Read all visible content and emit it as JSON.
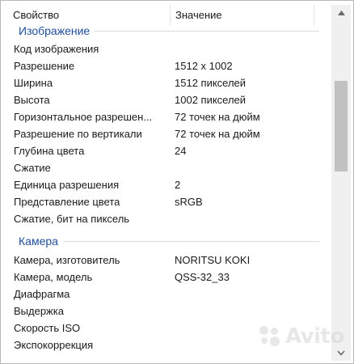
{
  "header": {
    "property_col": "Свойство",
    "value_col": "Значение"
  },
  "groups": [
    {
      "title": "Изображение",
      "rows": [
        {
          "property": "Код изображения",
          "value": ""
        },
        {
          "property": "Разрешение",
          "value": "1512 x 1002"
        },
        {
          "property": "Ширина",
          "value": "1512 пикселей"
        },
        {
          "property": "Высота",
          "value": "1002 пикселей"
        },
        {
          "property": "Горизонтальное разрешен...",
          "value": "72 точек на дюйм"
        },
        {
          "property": "Разрешение по вертикали",
          "value": "72 точек на дюйм"
        },
        {
          "property": "Глубина цвета",
          "value": "24"
        },
        {
          "property": "Сжатие",
          "value": ""
        },
        {
          "property": "Единица разрешения",
          "value": "2"
        },
        {
          "property": "Представление цвета",
          "value": "sRGB"
        },
        {
          "property": "Сжатие, бит на пиксель",
          "value": ""
        }
      ]
    },
    {
      "title": "Камера",
      "rows": [
        {
          "property": "Камера, изготовитель",
          "value": "NORITSU KOKI"
        },
        {
          "property": "Камера, модель",
          "value": "QSS-32_33"
        },
        {
          "property": "Диафрагма",
          "value": ""
        },
        {
          "property": "Выдержка",
          "value": ""
        },
        {
          "property": "Скорость ISO",
          "value": ""
        },
        {
          "property": "Экспокоррекция",
          "value": ""
        }
      ]
    }
  ],
  "scrollbar": {
    "up_icon": "triangle-up",
    "down_icon": "chevron-down"
  },
  "watermark": {
    "text": "Avito"
  }
}
